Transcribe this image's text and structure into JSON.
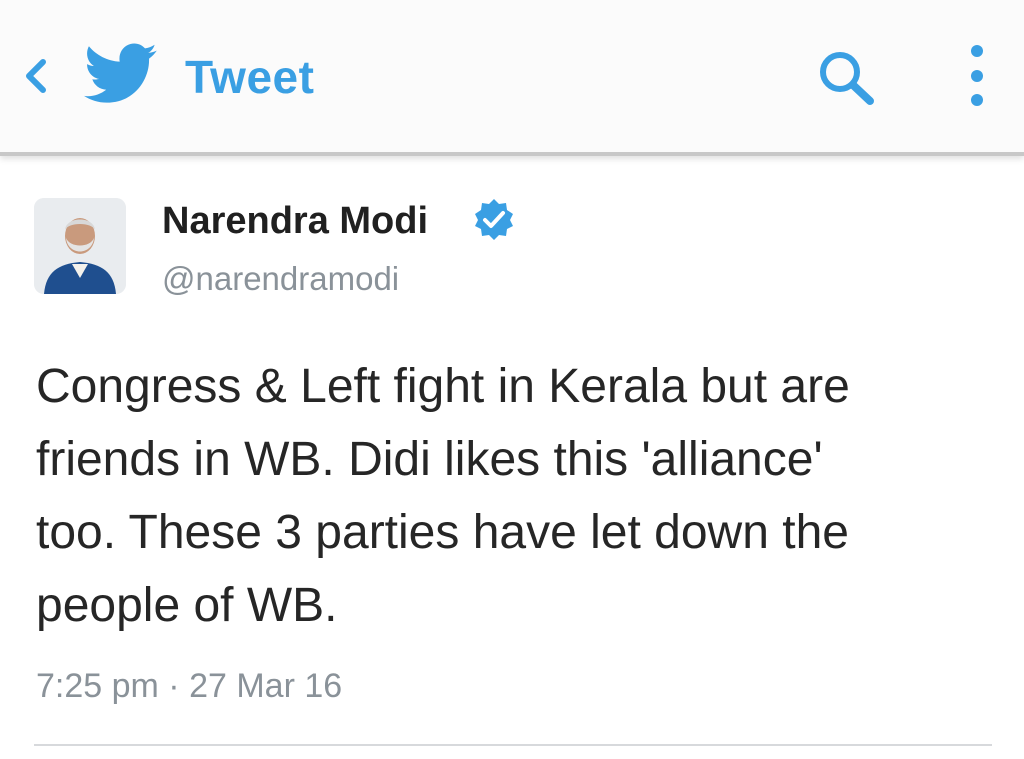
{
  "header": {
    "title": "Tweet",
    "back_icon": "chevron-left-icon",
    "logo_icon": "twitter-bird-icon",
    "search_icon": "search-icon",
    "menu_icon": "more-vertical-icon",
    "accent_color": "#3a9fe3"
  },
  "tweet": {
    "author_name": "Narendra Modi",
    "verified_icon": "verified-badge-icon",
    "handle": "@narendramodi",
    "text": "Congress & Left fight in Kerala but are\nfriends in WB. Didi likes this 'alliance'\ntoo. These 3 parties have let down the\npeople of WB.",
    "timestamp": "7:25 pm · 27 Mar 16"
  }
}
